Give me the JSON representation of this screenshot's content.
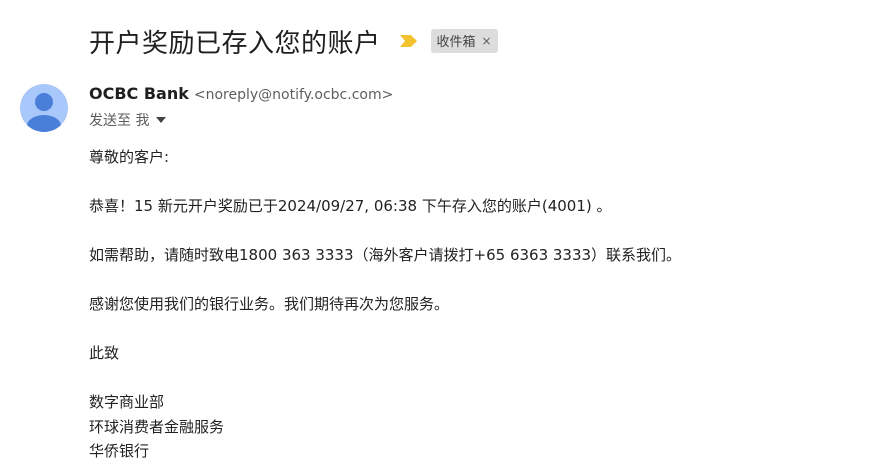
{
  "email": {
    "subject": "开户奖励已存入您的账户",
    "label": "收件箱",
    "label_close": "×",
    "sender_name": "OCBC Bank",
    "sender_email": "<noreply@notify.ocbc.com>",
    "to": "发送至 我",
    "body": {
      "greeting": "尊敬的客户:",
      "line1": "恭喜！15 新元开户奖励已于2024/09/27, 06:38 下午存入您的账户(4001) 。",
      "line2": "如需帮助，请随时致电1800 363 3333（海外客户请拨打+65 6363 3333）联系我们。",
      "line3": "感谢您使用我们的银行业务。我们期待再次为您服务。",
      "closing": "此致",
      "sig1": "数字商业部",
      "sig2": "环球消费者金融服务",
      "sig3": "华侨银行"
    }
  },
  "icons": {
    "importance": "importance-marker-icon",
    "avatar": "person-avatar-icon",
    "caret": "caret-down-icon"
  },
  "colors": {
    "importance": "#f2c230",
    "avatar_bg": "#a8c7fa",
    "avatar_fg": "#4a7fd9",
    "chip_bg": "#dddddd"
  }
}
